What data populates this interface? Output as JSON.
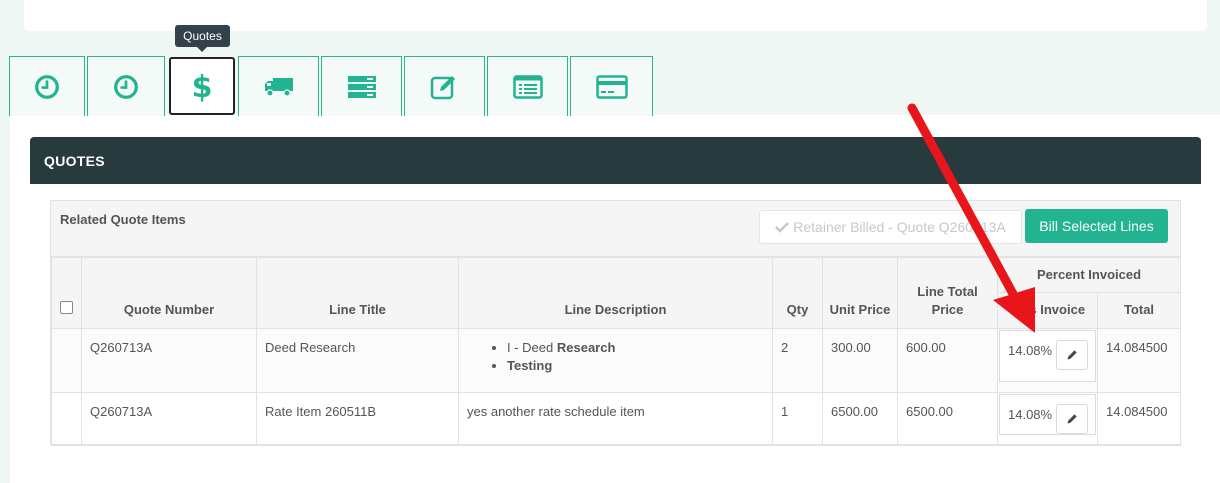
{
  "tooltip": "Quotes",
  "tabs": [
    {
      "icon": "clock-icon",
      "name": "tab-clock-1"
    },
    {
      "icon": "clock-icon",
      "name": "tab-clock-2"
    },
    {
      "icon": "dollar-icon",
      "name": "tab-quotes"
    },
    {
      "icon": "truck-icon",
      "name": "tab-shipping"
    },
    {
      "icon": "server-icon",
      "name": "tab-server"
    },
    {
      "icon": "edit-icon",
      "name": "tab-edit"
    },
    {
      "icon": "list-icon",
      "name": "tab-list"
    },
    {
      "icon": "credit-card-icon",
      "name": "tab-billing"
    }
  ],
  "panel": {
    "title": "QUOTES"
  },
  "quote_box": {
    "title": "Related Quote Items",
    "retainer_label": "Retainer Billed - Quote Q260713A",
    "bill_label": "Bill Selected Lines"
  },
  "table": {
    "headers": {
      "quote_number": "Quote Number",
      "line_title": "Line Title",
      "line_description": "Line Description",
      "qty": "Qty",
      "unit_price": "Unit Price",
      "line_total_price": "Line Total Price",
      "percent_invoiced": "Percent Invoiced",
      "invoice": "This Invoice",
      "total": "Total"
    },
    "rows": [
      {
        "quote_number": "Q260713A",
        "line_title": "Deed Research",
        "desc_items": [
          {
            "plain": "I - Deed ",
            "bold": "Research"
          },
          {
            "plain": "",
            "bold": "Testing"
          }
        ],
        "qty": "2",
        "unit_price": "300.00",
        "line_total": "600.00",
        "invoice_pct": "14.08%",
        "total": "14.084500"
      },
      {
        "quote_number": "Q260713A",
        "line_title": "Rate Item 260511B",
        "description": "yes another rate schedule item",
        "qty": "1",
        "unit_price": "6500.00",
        "line_total": "6500.00",
        "invoice_pct": "14.08%",
        "total": "14.084500"
      }
    ]
  },
  "colors": {
    "accent": "#22b391",
    "header": "#273a3d",
    "annotation_arrow": "#e8161b"
  }
}
